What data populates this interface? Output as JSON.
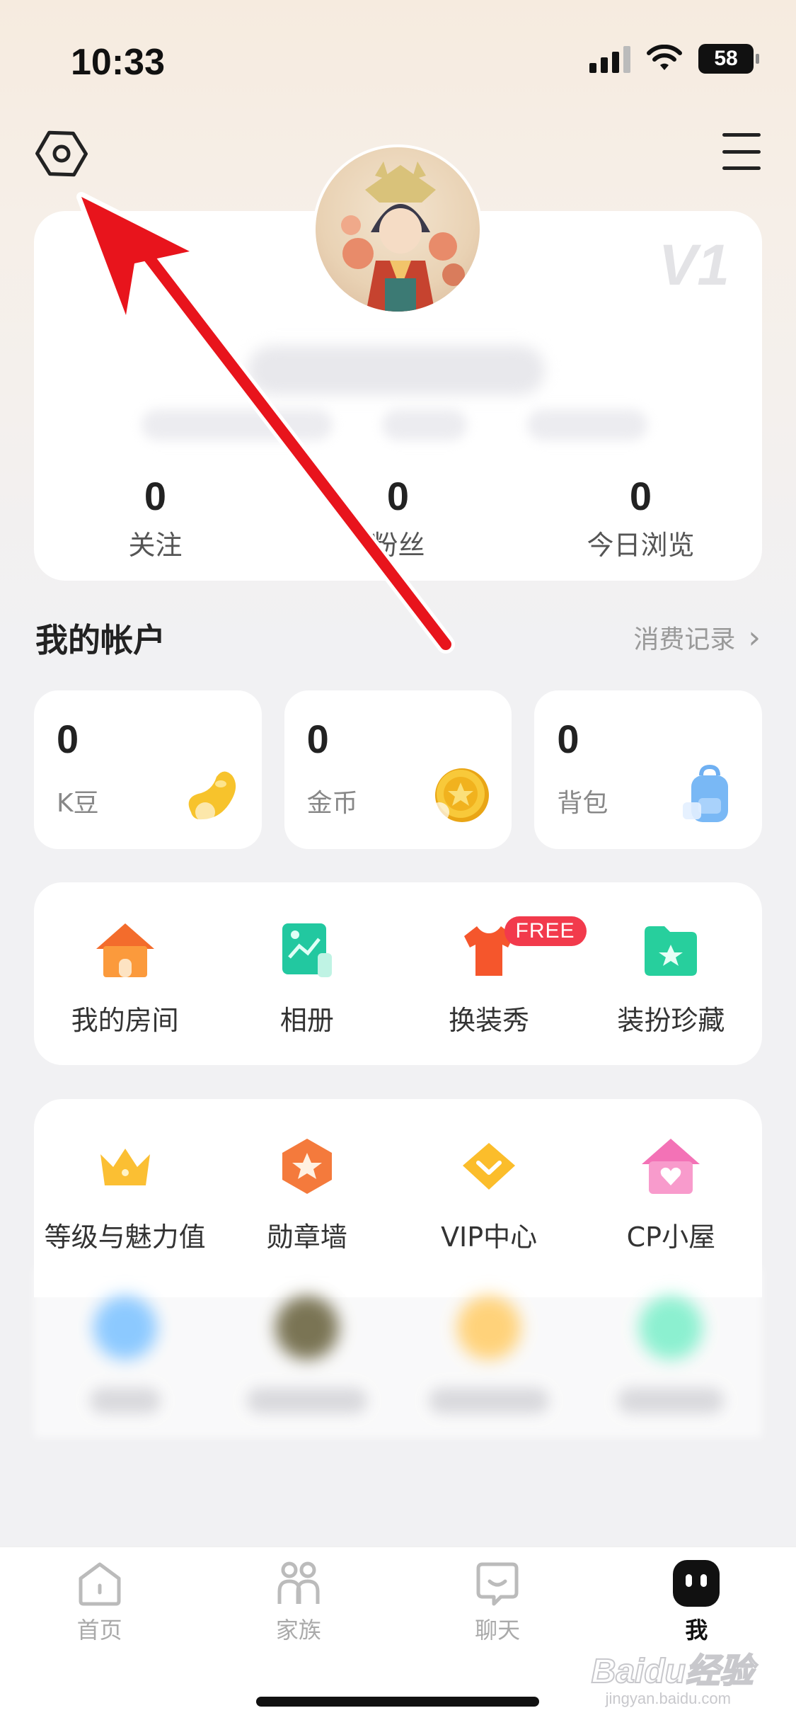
{
  "status_bar": {
    "time": "10:33",
    "battery": "58"
  },
  "profile": {
    "level": "V1",
    "stats": [
      {
        "value": "0",
        "label": "关注"
      },
      {
        "value": "0",
        "label": "粉丝"
      },
      {
        "value": "0",
        "label": "今日浏览"
      }
    ]
  },
  "account": {
    "title": "我的帐户",
    "records_label": "消费记录",
    "cards": [
      {
        "value": "0",
        "label": "K豆",
        "icon": "bean-icon"
      },
      {
        "value": "0",
        "label": "金币",
        "icon": "coin-icon"
      },
      {
        "value": "0",
        "label": "背包",
        "icon": "backpack-icon"
      }
    ]
  },
  "features_row1": [
    {
      "label": "我的房间",
      "icon": "house-icon"
    },
    {
      "label": "相册",
      "icon": "album-icon"
    },
    {
      "label": "换装秀",
      "icon": "tshirt-icon",
      "badge": "FREE"
    },
    {
      "label": "装扮珍藏",
      "icon": "folder-star-icon"
    }
  ],
  "features_row2": [
    {
      "label": "等级与魅力值",
      "icon": "crown-icon"
    },
    {
      "label": "勋章墙",
      "icon": "medal-icon"
    },
    {
      "label": "VIP中心",
      "icon": "vip-diamond-icon"
    },
    {
      "label": "CP小屋",
      "icon": "heart-house-icon"
    }
  ],
  "bottom_nav": [
    {
      "label": "首页",
      "icon": "home-icon",
      "active": false
    },
    {
      "label": "家族",
      "icon": "family-icon",
      "active": false
    },
    {
      "label": "聊天",
      "icon": "chat-icon",
      "active": false
    },
    {
      "label": "我",
      "icon": "me-icon",
      "active": true
    }
  ],
  "watermark": {
    "text": "Baidu经验",
    "sub": "jingyan.baidu.com"
  },
  "colors": {
    "accent_red": "#f23a4c",
    "annotation_arrow": "#e8141c"
  }
}
